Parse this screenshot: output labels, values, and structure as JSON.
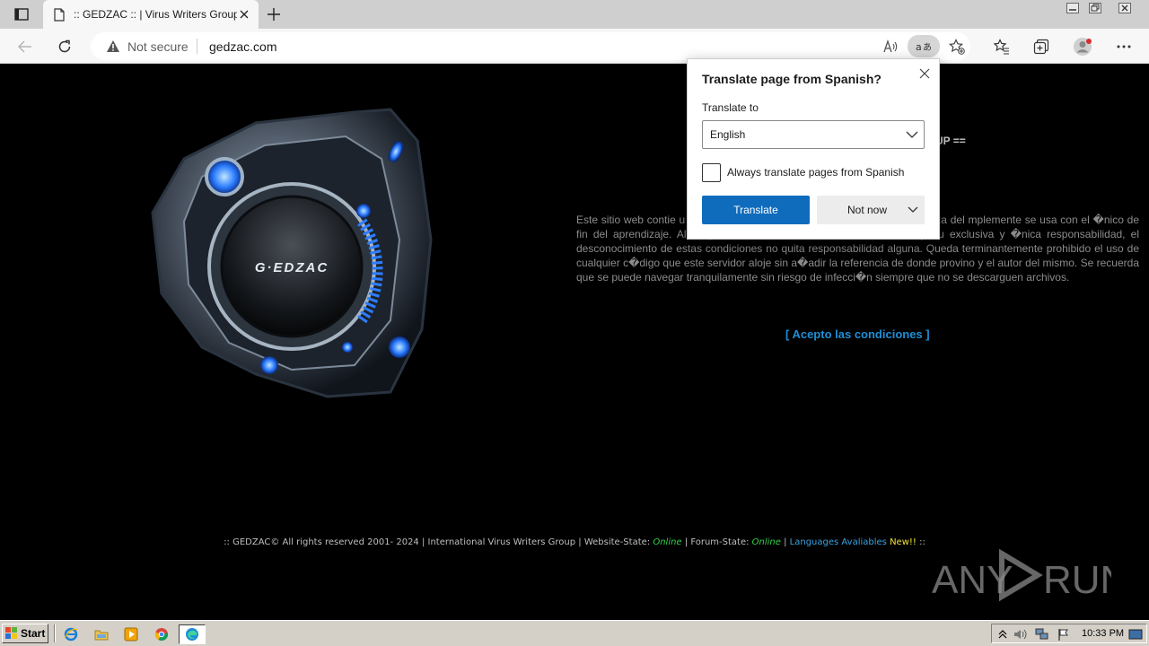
{
  "browser": {
    "tab_title": ":: GEDZAC :: | Virus Writers Group",
    "security_label": "Not secure",
    "url": "gedzac.com"
  },
  "page": {
    "logo_text": "G·EDZAC",
    "header_fragment": "UP ==",
    "notice_text": "Este sitio web contie                                                              u PC si es descargado. GEDZAC NO se responsabiliza del                                                             mplemente se usa con el �nico de fin del aprendizaje. Al aceptar estas condiciones, estas entrando bajo tu exclusiva y �nica responsabilidad, el desconocimiento de estas condiciones no quita responsabilidad alguna. Queda terminantemente prohibido el uso de cualquier c�digo que este servidor aloje sin a�adir la referencia de donde provino y el autor del mismo. Se recuerda que se puede navegar tranquilamente sin riesgo de infecci�n siempre que no se descarguen archivos.",
    "accept_link": "[ Acepto las condiciones ]",
    "footer": {
      "prefix": ":: GEDZAC© All rights reserved 2001- 2024 | International Virus Writers Group | Website-State: ",
      "website_state": "Online",
      "forum_label": " | Forum-State: ",
      "forum_state": "Online",
      "sep": " | ",
      "languages": "Languages Avaliables",
      "new_badge": "New!!",
      "suffix": " ::"
    },
    "watermark": "ANY RUN"
  },
  "translate_popup": {
    "title": "Translate page from Spanish?",
    "translate_to_label": "Translate to",
    "selected_language": "English",
    "always_label": "Always translate pages from Spanish",
    "always_checked": false,
    "translate_button": "Translate",
    "not_now_button": "Not now"
  },
  "taskbar": {
    "start_label": "Start",
    "clock": "10:33 PM"
  },
  "colors": {
    "accept_link": "#1e8fd6",
    "online": "#2fd34a",
    "new": "#f3e23b",
    "translate_button": "#0f6cbd"
  }
}
